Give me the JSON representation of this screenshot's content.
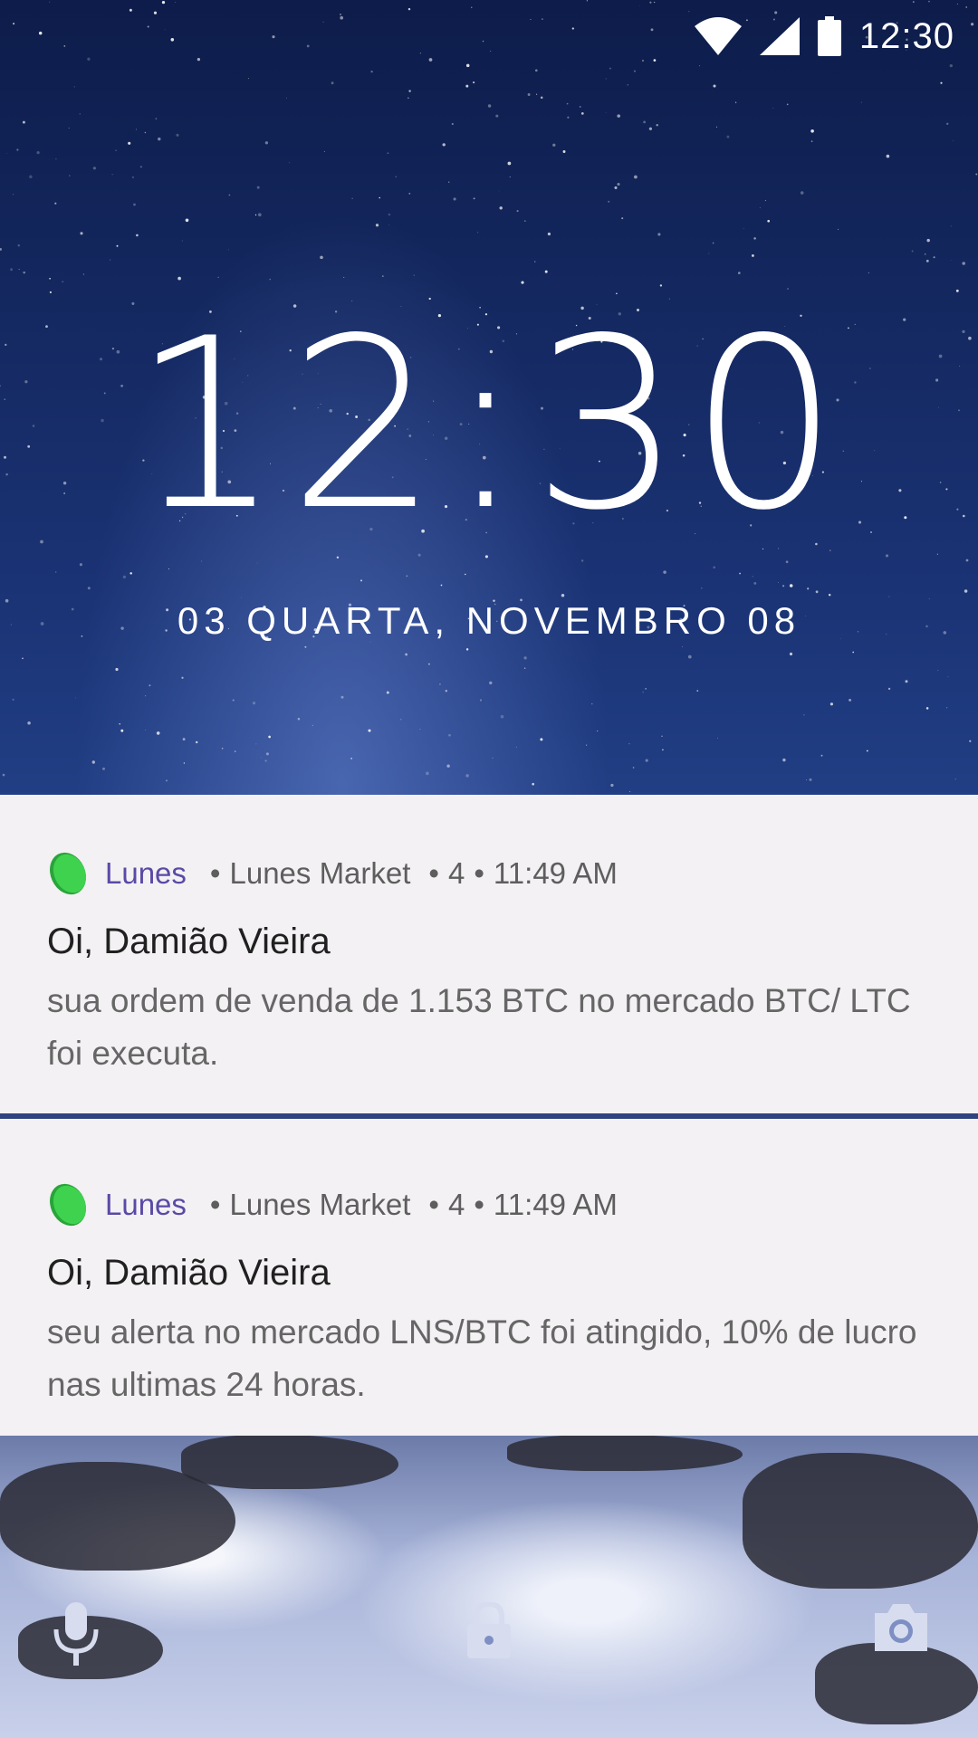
{
  "status_bar": {
    "time": "12:30"
  },
  "lockscreen": {
    "clock": "12:30",
    "date": "03 QUARTA, NOVEMBRO 08"
  },
  "notifications": [
    {
      "app": "Lunes",
      "channel": "Lunes Market",
      "count": "4",
      "time": "11:49 AM",
      "title": "Oi, Damião Vieira",
      "body": "sua ordem de venda de 1.153 BTC no mercado BTC/ LTC foi executa."
    },
    {
      "app": "Lunes",
      "channel": "Lunes Market",
      "count": "4",
      "time": "11:49 AM",
      "title": "Oi, Damião Vieira",
      "body": "seu alerta no mercado LNS/BTC foi atingido, 10% de lucro nas ultimas 24 horas."
    }
  ],
  "bottom_actions": {
    "left": "microphone-icon",
    "center": "lock-icon",
    "right": "camera-icon"
  },
  "colors": {
    "app_accent": "#5b49a6",
    "app_icon": "#3fd24f",
    "card_bg": "#f3f1f3"
  }
}
